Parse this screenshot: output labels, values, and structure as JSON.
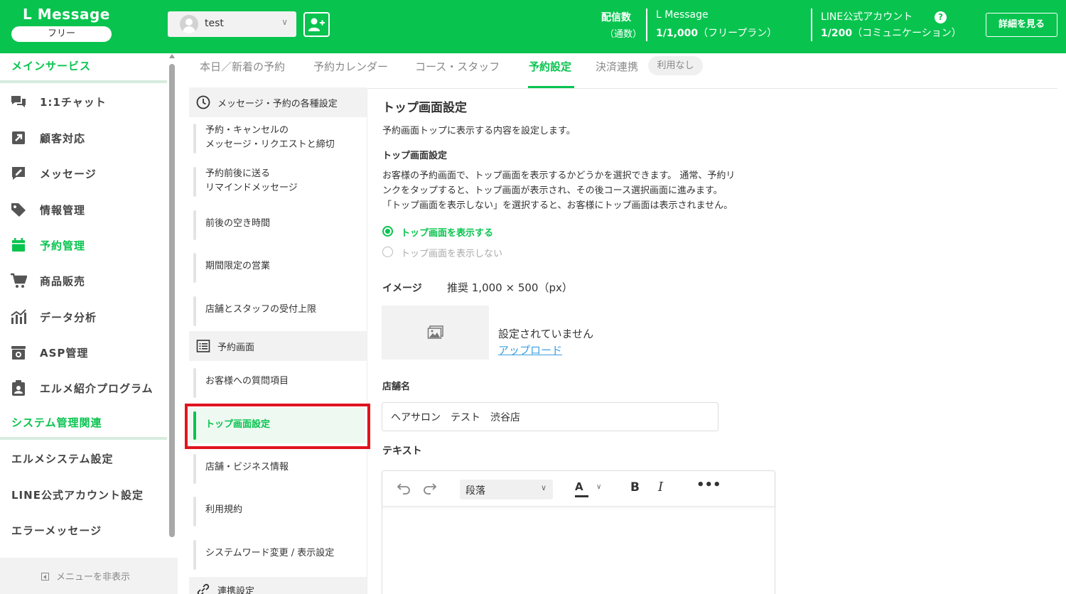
{
  "header": {
    "app_title": "L Message",
    "plan": "フリー",
    "account_name": "test",
    "send_label": "配信数",
    "send_sub": "（通数）",
    "lmessage_title": "L Message",
    "lmessage_value": "1/1,000",
    "lmessage_plan": "（フリープラン）",
    "line_title": "LINE公式アカウント",
    "line_value": "1/200",
    "line_plan": "（コミュニケーション）",
    "help": "?",
    "detail_button": "詳細を見る"
  },
  "sidebar": {
    "main_section": "メインサービス",
    "items": [
      {
        "label": "1:1チャット",
        "icon": "chat-icon"
      },
      {
        "label": "顧客対応",
        "icon": "arrow-box-icon"
      },
      {
        "label": "メッセージ",
        "icon": "message-edit-icon"
      },
      {
        "label": "情報管理",
        "icon": "tag-icon"
      },
      {
        "label": "予約管理",
        "icon": "calendar-icon"
      },
      {
        "label": "商品販売",
        "icon": "cart-icon"
      },
      {
        "label": "データ分析",
        "icon": "bar-chart-icon"
      },
      {
        "label": "ASP管理",
        "icon": "asp-icon"
      },
      {
        "label": "エルメ紹介プログラム",
        "icon": "clipboard-user-icon"
      }
    ],
    "system_section": "システム管理関連",
    "system_items": [
      "エルメシステム設定",
      "LINE公式アカウント設定",
      "エラーメッセージ"
    ],
    "hide_menu": "メニューを非表示"
  },
  "tabs": [
    {
      "label": "本日／新着の予約"
    },
    {
      "label": "予約カレンダー"
    },
    {
      "label": "コース・スタッフ"
    },
    {
      "label": "予約設定"
    },
    {
      "label": "決済連携"
    }
  ],
  "tab_badge": "利用なし",
  "submenu": {
    "group1": "メッセージ・予約の各種設定",
    "group1_items": [
      [
        "予約・キャンセルの",
        "メッセージ・リクエストと締切"
      ],
      [
        "予約前後に送る",
        "リマインドメッセージ"
      ],
      [
        "前後の空き時間"
      ],
      [
        "期間限定の営業"
      ],
      [
        "店舗とスタッフの受付上限"
      ]
    ],
    "group2": "予約画面",
    "group2_items": [
      "お客様への質問項目",
      "トップ画面設定",
      "店舗・ビジネス情報",
      "利用規約",
      "システムワード変更 / 表示設定"
    ],
    "group3": "連携設定"
  },
  "content": {
    "title": "トップ画面設定",
    "description": "予約画面トップに表示する内容を設定します。",
    "section_title": "トップ画面設定",
    "para_lines": [
      "お客様の予約画面で、トップ画面を表示するかどうかを選択できます。 通常、予約リ",
      "ンクをタップすると、トップ画面が表示され、その後コース選択画面に進みます。",
      "「トップ画面を表示しない」を選択すると、お客様にトップ画面は表示されません。"
    ],
    "radio_show": "トップ画面を表示する",
    "radio_hide": "トップ画面を表示しない",
    "image_label": "イメージ",
    "image_recommend": "推奨 1,000 × 500（px）",
    "not_set": "設定されていません",
    "upload": "アップロード",
    "store_label": "店舗名",
    "store_value": "ヘアサロン　テスト　渋谷店",
    "text_label": "テキスト",
    "editor": {
      "paragraph": "段落",
      "color_letter": "A",
      "bold": "B",
      "italic": "I",
      "more": "•••"
    }
  },
  "colors": {
    "brand": "#08c44f",
    "highlight_frame": "#e0141e",
    "link": "#3d9fe0"
  }
}
